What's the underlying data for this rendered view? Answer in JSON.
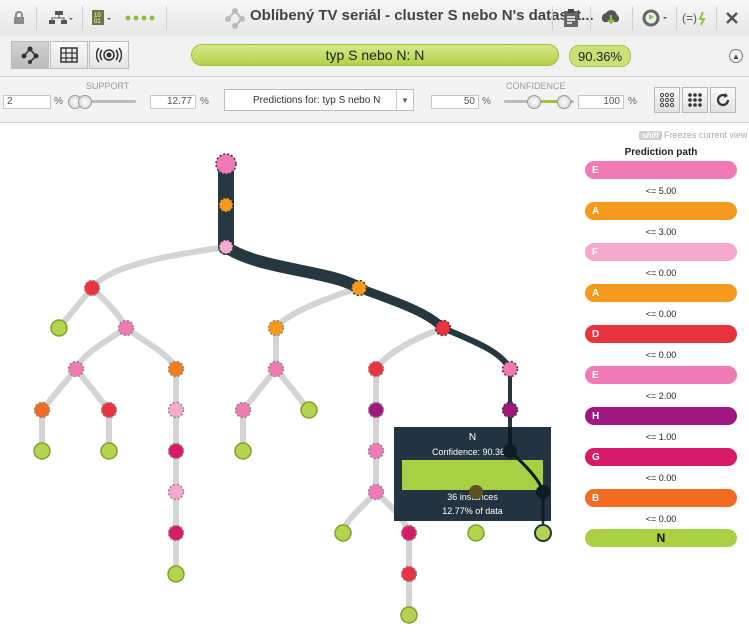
{
  "header": {
    "title": "Oblíbený TV seriál - cluster S nebo N's dataset..."
  },
  "prediction": {
    "label": "typ S nebo N: N",
    "percent": "90.36%"
  },
  "support": {
    "label": "SUPPORT",
    "min": "2",
    "max": "12.77",
    "unit": "%"
  },
  "predictions_for": {
    "label": "Predictions for: typ S nebo N"
  },
  "confidence": {
    "label": "CONFIDENCE",
    "min": "50",
    "max": "100",
    "unit": "%"
  },
  "freeze": {
    "key": "shift",
    "label": "Freezes current view"
  },
  "prediction_path": {
    "title": "Prediction path",
    "steps": [
      {
        "field": "E",
        "cond": "<= 5.00",
        "color": "#f07ab4"
      },
      {
        "field": "A",
        "cond": "<= 3.00",
        "color": "#f59a1e"
      },
      {
        "field": "F",
        "cond": "<= 0.00",
        "color": "#f6a9cf"
      },
      {
        "field": "A",
        "cond": "<= 0.00",
        "color": "#f59a1e"
      },
      {
        "field": "D",
        "cond": "<= 0.00",
        "color": "#e8343e"
      },
      {
        "field": "E",
        "cond": "<= 2.00",
        "color": "#f07ab4"
      },
      {
        "field": "H",
        "cond": "<= 1.00",
        "color": "#a0177f"
      },
      {
        "field": "G",
        "cond": "<= 0.00",
        "color": "#d81b68"
      },
      {
        "field": "B",
        "cond": "<= 0.00",
        "color": "#f26b20"
      }
    ],
    "result": "N",
    "result_color": "#a9cf45"
  },
  "tooltip": {
    "title": "N",
    "confidence": "Confidence: 90.36%",
    "instances": "36 instances",
    "data": "12.77% of data"
  }
}
